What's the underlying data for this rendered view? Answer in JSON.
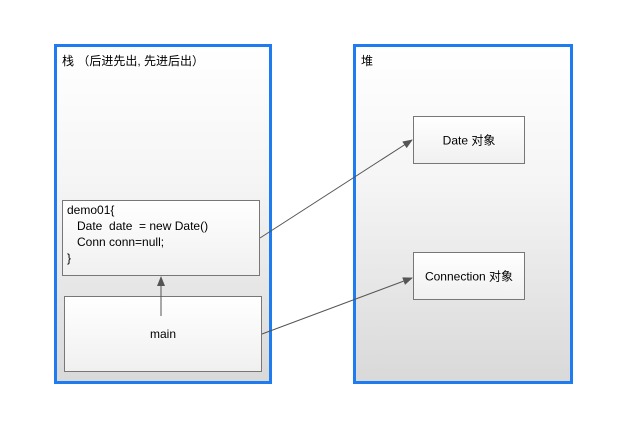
{
  "stack": {
    "title": "栈 （后进先出, 先进后出）",
    "frames": {
      "demo01": {
        "lines": [
          "demo01{",
          "   Date  date  = new Date()",
          "   Conn conn=null;",
          "}"
        ]
      },
      "main": {
        "label": "main"
      }
    }
  },
  "heap": {
    "title": "堆",
    "objects": {
      "date": {
        "label": "Date  对象"
      },
      "connection": {
        "label": "Connection 对象"
      }
    }
  },
  "colors": {
    "region_border": "#1e7bf0",
    "arrow": "#555555"
  }
}
